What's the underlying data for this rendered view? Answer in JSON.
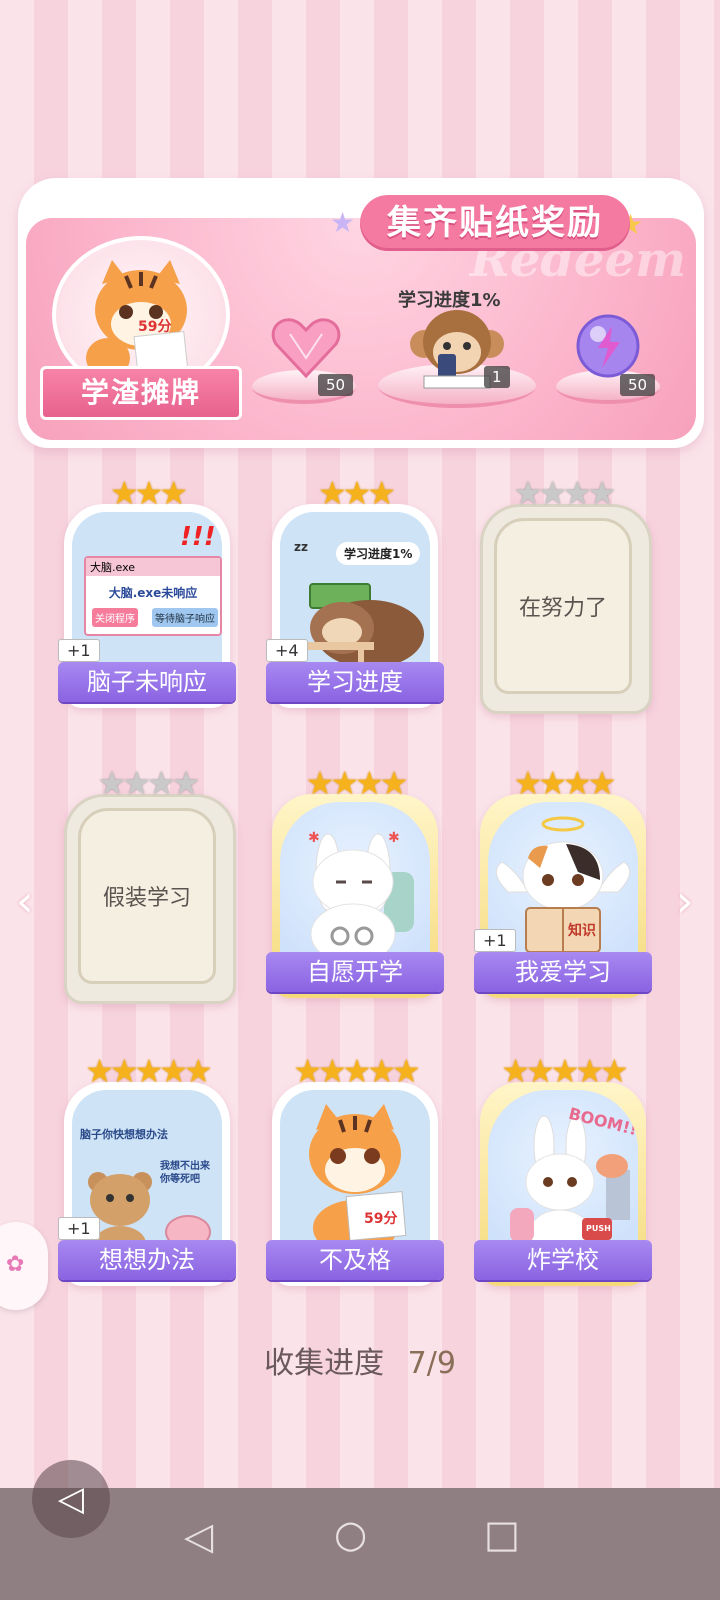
{
  "banner": {
    "title": "集齐贴纸奖励",
    "watermark": "Redeem",
    "avatar_label": "学渣摊牌",
    "avatar_score": "59分",
    "progress_label": "学习进度1%",
    "rewards": [
      {
        "icon": "heart-gem-icon",
        "count": "50"
      },
      {
        "icon": "monkey-sticker-icon",
        "count": "1"
      },
      {
        "icon": "lightning-orb-icon",
        "count": "50"
      }
    ]
  },
  "cards": [
    {
      "name": "脑子未响应",
      "stars": 3,
      "max_stars": 3,
      "owned": true,
      "extra": "+1",
      "art": "brain-not-responding",
      "window_title": "大脑.exe",
      "window_msg": "大脑.exe未响应",
      "btn_close": "关闭程序",
      "btn_wait": "等待脑子响应",
      "marks": "!!!"
    },
    {
      "name": "学习进度",
      "stars": 3,
      "max_stars": 3,
      "owned": true,
      "extra": "+4",
      "art": "sleeping-sloth",
      "bubble": "学习进度1%",
      "zz": "zz"
    },
    {
      "name": "在努力了",
      "stars": 0,
      "max_stars": 4,
      "owned": false
    },
    {
      "name": "假装学习",
      "stars": 0,
      "max_stars": 4,
      "owned": false
    },
    {
      "name": "自愿开学",
      "stars": 4,
      "max_stars": 4,
      "owned": true,
      "art": "bunny-handcuffed"
    },
    {
      "name": "我爱学习",
      "stars": 4,
      "max_stars": 4,
      "owned": true,
      "extra": "+1",
      "art": "angel-cat",
      "book": "知识"
    },
    {
      "name": "想想办法",
      "stars": 5,
      "max_stars": 5,
      "owned": true,
      "extra": "+1",
      "art": "bear-and-brain",
      "caption_top": "脑子你快想想办法",
      "caption_brain": "我想不出来\n你等死吧"
    },
    {
      "name": "不及格",
      "stars": 5,
      "max_stars": 5,
      "owned": true,
      "art": "crying-tiger",
      "score": "59分"
    },
    {
      "name": "炸学校",
      "stars": 5,
      "max_stars": 5,
      "owned": true,
      "art": "bunny-boom",
      "boom": "BOOM!!",
      "push": "PUSH"
    }
  ],
  "collection": {
    "label": "收集进度",
    "value": "7/9"
  },
  "colors": {
    "accent_pink": "#f47aa1",
    "label_purple": "#8a63e2",
    "star_gold": "#f6b21c"
  }
}
